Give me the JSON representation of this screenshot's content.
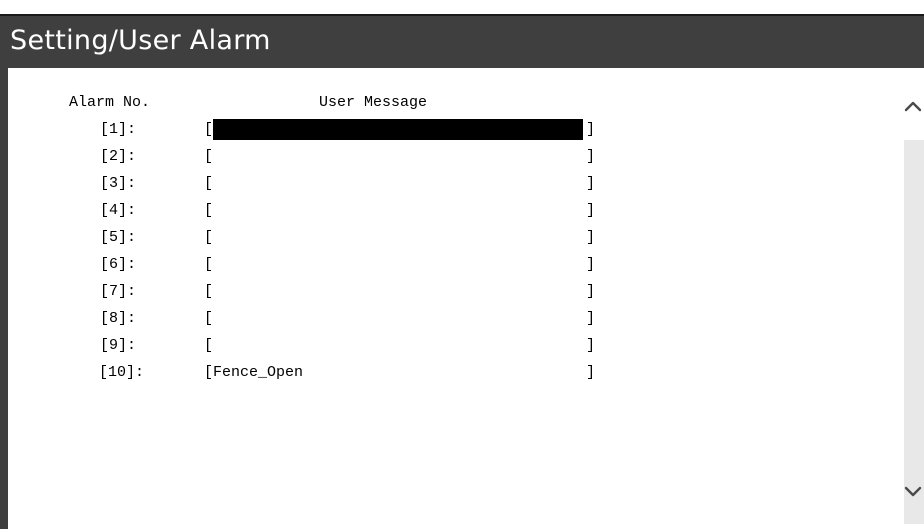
{
  "window": {
    "title": "Setting/User Alarm"
  },
  "headers": {
    "alarm_no": "Alarm No.",
    "user_message": "User Message"
  },
  "bracket_open": "[",
  "bracket_close": "]",
  "alarms": [
    {
      "label": "[1]:",
      "message": ""
    },
    {
      "label": "[2]:",
      "message": ""
    },
    {
      "label": "[3]:",
      "message": ""
    },
    {
      "label": "[4]:",
      "message": ""
    },
    {
      "label": "[5]:",
      "message": ""
    },
    {
      "label": "[6]:",
      "message": ""
    },
    {
      "label": "[7]:",
      "message": ""
    },
    {
      "label": "[8]:",
      "message": ""
    },
    {
      "label": "[9]:",
      "message": ""
    },
    {
      "label": "[10]:",
      "message": "Fence_Open"
    }
  ],
  "active_row": 1,
  "icons": {
    "scroll_up": "chevron-up-icon",
    "scroll_down": "chevron-down-icon"
  },
  "colors": {
    "titlebar": "#3f3f3f",
    "title_text": "#ffffff",
    "active_field": "#000000",
    "scroll_track": "#e8e8e8"
  }
}
